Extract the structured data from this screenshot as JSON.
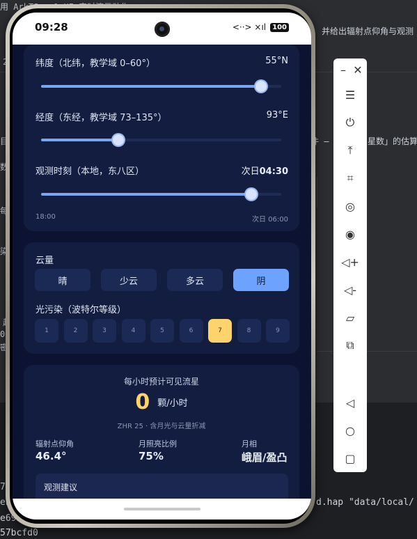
{
  "ide": {
    "line_top": "用 ArkTS · 1 UI 实时演示动作",
    "line_right1": "并给出辐射点仰角与观测",
    "line_left2": "2",
    "line_mid1": "件 —",
    "line_mid2": "星数」的估算",
    "frag_1": "目自",
    "frag_2": "数给",
    "frag_3": "每",
    "frag_4": "染",
    "frag_5": "起",
    "frag_6": "0",
    "frag_7": "密",
    "bottom_1": "7b",
    "bottom_2": "ent",
    "bottom_3": "e69b",
    "bottom_4": "57bcfd0",
    "bottom_right": "d.hap \"data/local/"
  },
  "status": {
    "time": "09:28",
    "signal": "<··> ×ıl",
    "battery": "100"
  },
  "latitude": {
    "label": "纬度（北纬，教学域 0–60°）",
    "value": "55°N",
    "fraction": 0.916
  },
  "longitude": {
    "label": "经度（东经，教学域 73–135°）",
    "value": "93°E",
    "fraction": 0.323
  },
  "time_slider": {
    "label": "观测时刻（本地，东八区）",
    "value_prefix": "次日",
    "value_time": "04:30",
    "min_label": "18:00",
    "max_label": "次日 06:00",
    "fraction": 0.875
  },
  "cloud": {
    "label": "云量",
    "options": [
      "晴",
      "少云",
      "多云",
      "阴"
    ],
    "selected": "阴"
  },
  "light_pollution": {
    "label": "光污染（波特尔等级）",
    "levels": [
      "1",
      "2",
      "3",
      "4",
      "5",
      "6",
      "7",
      "8",
      "9"
    ],
    "selected": "7"
  },
  "result": {
    "title": "每小时预计可见流星",
    "count": "0",
    "unit": "颗/小时",
    "note": "ZHR 25 · 含月光与云量折减",
    "stats": [
      {
        "label": "辐射点仰角",
        "value": "46.4°"
      },
      {
        "label": "月照亮比例",
        "value": "75%"
      },
      {
        "label": "月相",
        "value": "峨眉/盈凸"
      }
    ],
    "advice_title": "观测建议"
  },
  "toolbar": {
    "items": [
      "minimize-icon",
      "close-icon",
      "menu-icon",
      "power-icon",
      "pin-top-icon",
      "crop-icon",
      "rotate-icon",
      "screenshot-icon",
      "volume-up-icon",
      "volume-down-icon",
      "shake-icon",
      "multi-device-icon",
      "back-icon",
      "home-icon",
      "recent-icon"
    ]
  }
}
